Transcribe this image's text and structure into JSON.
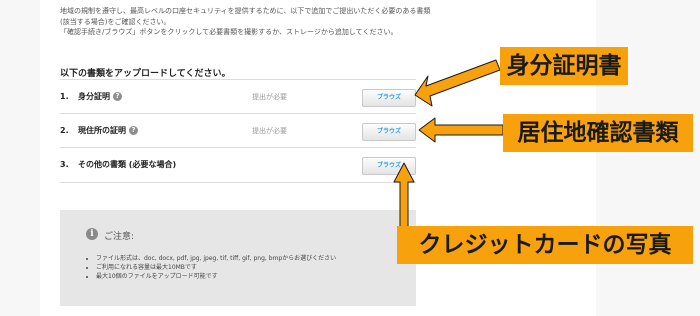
{
  "intro": {
    "line1": "地域の規制を遵守し、最高レベルの口座セキュリティを提供するために、以下で追加でご提出いただく必要のある書類",
    "line2": "(該当する場合)をご確認ください。",
    "line3": "「確認手続き/ブラウズ」ボタンをクリックして必要書類を撮影するか、ストレージから追加してください。"
  },
  "section_heading": "以下の書類をアップロードしてください。",
  "documents": [
    {
      "num": "1.",
      "title": "身分証明",
      "help_icon": "question-circle-icon",
      "status": "提出が必要",
      "button": "ブラウズ"
    },
    {
      "num": "2.",
      "title": "現住所の証明",
      "help_icon": "question-circle-icon",
      "status": "提出が必要",
      "button": "ブラウズ"
    },
    {
      "num": "3.",
      "title": "その他の書類 (必要な場合)",
      "status": "",
      "button": "ブラウズ"
    }
  ],
  "notice": {
    "icon": "info-icon",
    "title": "ご注意:",
    "items": [
      "ファイル形式は、doc, docx, pdf, jpg, jpeg, tif, tiff, gif, png, bmpからお選びください",
      "ご利用になれる容量は最大10MBです",
      "最大10個のファイルをアップロード可能です"
    ]
  },
  "annotations": {
    "callout1": "身分証明書",
    "callout2": "居住地確認書類",
    "callout3": "クレジットカードの写真",
    "color": "#f7a10c"
  }
}
